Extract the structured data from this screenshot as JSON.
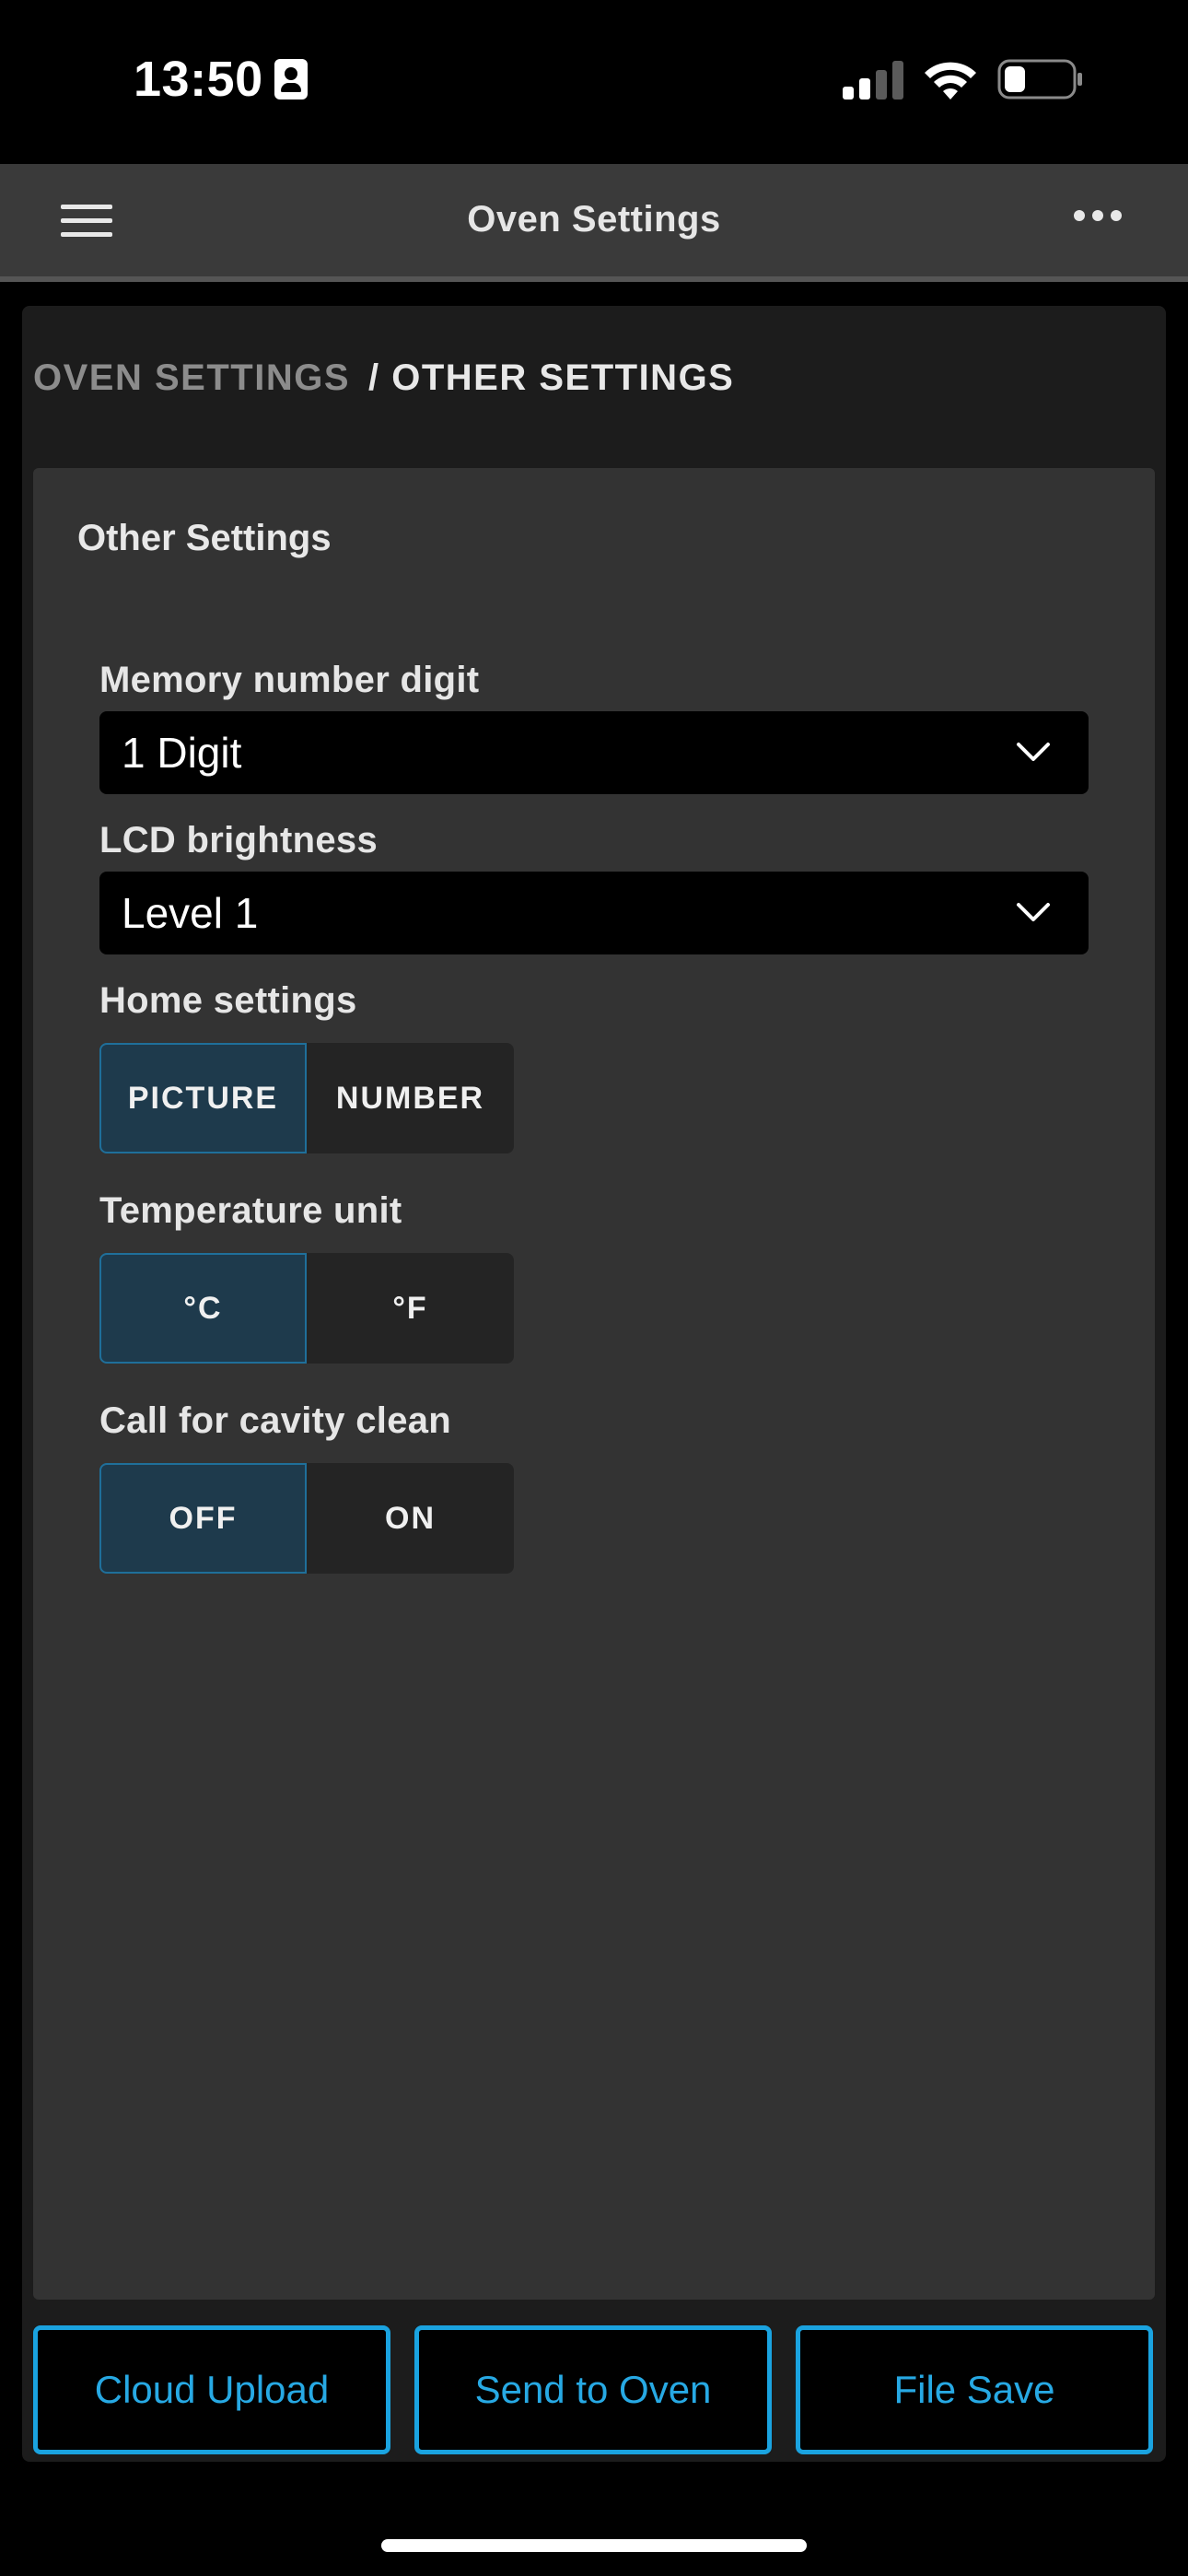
{
  "status_bar": {
    "time": "13:50",
    "icons": [
      "contact-card-icon",
      "cellular-signal-icon",
      "wifi-icon",
      "battery-icon"
    ]
  },
  "header": {
    "title": "Oven Settings",
    "left_icon": "menu-icon",
    "right_icon": "more-icon"
  },
  "breadcrumb": {
    "root": "OVEN SETTINGS",
    "current": "/ OTHER SETTINGS"
  },
  "card": {
    "title": "Other Settings",
    "memory_digit": {
      "label": "Memory number digit",
      "value": "1 Digit"
    },
    "lcd_brightness": {
      "label": "LCD brightness",
      "value": "Level 1"
    },
    "home_settings": {
      "label": "Home settings",
      "options": [
        "PICTURE",
        "NUMBER"
      ],
      "selected": "PICTURE"
    },
    "temperature_unit": {
      "label": "Temperature unit",
      "options": [
        "°C",
        "°F"
      ],
      "selected": "°C"
    },
    "cavity_clean": {
      "label": "Call for cavity clean",
      "options": [
        "OFF",
        "ON"
      ],
      "selected": "OFF"
    }
  },
  "actions": {
    "cloud_upload": "Cloud Upload",
    "send_to_oven": "Send to Oven",
    "file_save": "File Save"
  },
  "colors": {
    "accent": "#1aa3e0",
    "active_toggle_bg": "#1e3a4c",
    "card_bg": "#333333",
    "header_bg": "#3a3a3a"
  }
}
